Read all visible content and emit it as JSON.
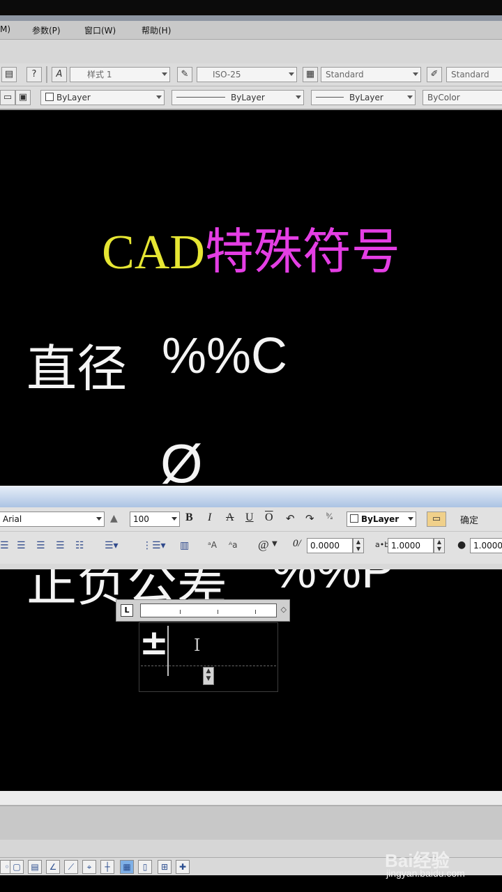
{
  "menubar": {
    "items": [
      "M)",
      "参数(P)",
      "窗口(W)",
      "帮助(H)"
    ]
  },
  "toolbar1": {
    "text_style": "样式 1",
    "dim_style": "ISO-25",
    "table_style": "Standard",
    "multileader_style": "Standard"
  },
  "toolbar2": {
    "layer_color": "ByLayer",
    "linetype": "ByLayer",
    "lineweight": "ByLayer",
    "plot_style": "ByColor"
  },
  "drawing": {
    "title_prefix": "CAD",
    "title_chinese": "特殊符号",
    "row1_label": "直径",
    "row1_code": "%%C",
    "diameter_symbol": "Ø",
    "row2_label": "正负公差",
    "row2_code": "%%P",
    "editor_text": "±",
    "ruler_label": "L",
    "ibeam_cursor": "I"
  },
  "text_format": {
    "font": "Arial",
    "height": "100",
    "bold": "B",
    "italic": "I",
    "strike": "A",
    "underline": "U",
    "overline": "O",
    "color": "ByLayer",
    "ok_button": "确定",
    "at_symbol": "@",
    "oblique_value": "0.0000",
    "tracking_value": "1.0000",
    "width_value": "1.0000"
  },
  "watermark": {
    "logo": "Bai经验",
    "url": "jingyan.baidu.com"
  },
  "colors": {
    "background": "#000000",
    "title_yellow": "#e6e633",
    "title_magenta": "#e43ee4",
    "text_white": "#f4f4f4"
  }
}
